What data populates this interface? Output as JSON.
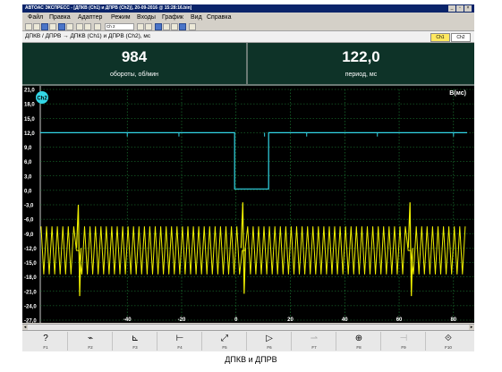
{
  "window": {
    "title": "АВТОАС ЭКСПРЕСС - [ДПКВ (Ch1) и ДПРВ (Ch2)], 20-09-2016 @ 15:28:16.bin]",
    "controls": [
      "_",
      "▫",
      "×"
    ]
  },
  "menu": [
    "Файл",
    "Правка",
    "Адаптер",
    "Режим",
    "Входы",
    "График",
    "Вид",
    "Справка"
  ],
  "toolbar": {
    "channel_select": "Ch 2"
  },
  "pathbar": {
    "path": "ДПКВ / ДПРВ → ДПКВ (Ch1) и ДПРВ (Ch2), мс",
    "tabs": [
      "Ch1",
      "Ch2"
    ],
    "active_tab": "Ch1"
  },
  "readouts": [
    {
      "value": "984",
      "label": "обороты, об/мин"
    },
    {
      "value": "122,0",
      "label": "период, мс"
    }
  ],
  "chart_data": {
    "type": "line",
    "units_label": "В(мс)",
    "channel_badge": "Ch2",
    "y_ticks": [
      "21,0",
      "18,0",
      "15,0",
      "12,0",
      "9,0",
      "6,0",
      "3,0",
      "0,0",
      "-3,0",
      "-6,0",
      "-9,0",
      "-12,0",
      "-15,0",
      "-18,0",
      "-21,0",
      "-24,0",
      "-27,0"
    ],
    "y_range": [
      -27,
      21
    ],
    "x_ticks": [
      "-40",
      "-20",
      "0",
      "20",
      "40",
      "60",
      "80"
    ],
    "x_range": [
      -72,
      85
    ],
    "series": [
      {
        "channel": "Ch2",
        "color": "#33d6e6",
        "style": "step",
        "points": [
          [
            -72,
            12.0
          ],
          [
            -0.5,
            12.0
          ],
          [
            -0.5,
            0.3
          ],
          [
            12.0,
            0.3
          ],
          [
            12.0,
            12.0
          ],
          [
            85,
            12.0
          ]
        ]
      },
      {
        "channel": "Ch1",
        "color": "#f0f000",
        "style": "oscillation",
        "upper": -7.5,
        "lower": -17.5,
        "cycles_per_unit": 0.5,
        "sync_marks": [
          [
            -58,
            -3.0,
            -22.0
          ],
          [
            2.5,
            -2.5,
            -21.5
          ],
          [
            64,
            -2.5,
            -22.0
          ]
        ]
      }
    ],
    "grid": true
  },
  "fkeys": [
    {
      "icon": "?",
      "key": "F1",
      "disabled": false
    },
    {
      "icon": "⌁",
      "key": "F2",
      "disabled": false
    },
    {
      "icon": "⊾",
      "key": "F3",
      "disabled": false
    },
    {
      "icon": "⊢",
      "key": "F4",
      "disabled": false
    },
    {
      "icon": "⤢",
      "key": "F5",
      "disabled": false
    },
    {
      "icon": "▷",
      "key": "F6",
      "disabled": false
    },
    {
      "icon": "⇀",
      "key": "F7",
      "disabled": true
    },
    {
      "icon": "⊕",
      "key": "F8",
      "disabled": false
    },
    {
      "icon": "⊣",
      "key": "F9",
      "disabled": true
    },
    {
      "icon": "⟐",
      "key": "F10",
      "disabled": false
    }
  ],
  "caption": "ДПКВ и ДПРВ"
}
